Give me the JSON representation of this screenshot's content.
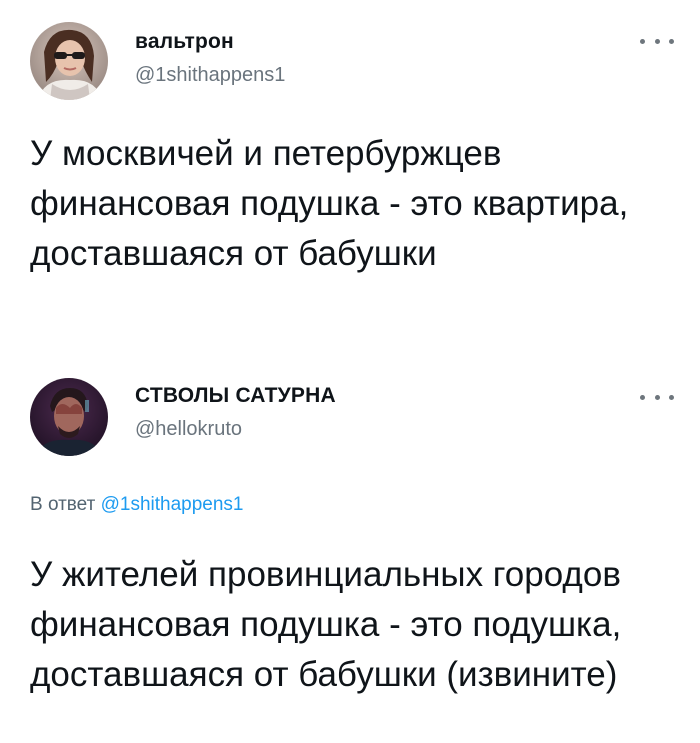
{
  "tweets": [
    {
      "author": {
        "display_name": "вальтрон",
        "handle": "@1shithappens1",
        "avatar_icon": "avatar-photo-woman-sunglasses"
      },
      "more_icon": "more-horizontal-icon",
      "text": "У москвичей и петербуржцев финансовая подушка - это квартира, доставшаяся от бабушки"
    },
    {
      "author": {
        "display_name": "СТВОЛЫ САТУРНА",
        "handle": "@hellokruto",
        "avatar_icon": "avatar-photo-man-dark-purple"
      },
      "more_icon": "more-horizontal-icon",
      "reply": {
        "prefix": "В ответ",
        "mention": "@1shithappens1"
      },
      "text": "У жителей провинциальных городов финансовая подушка - это подушка, доставшаяся от бабушки (извините)"
    }
  ],
  "colors": {
    "text": "#0f1419",
    "secondary": "#6a747d",
    "mention": "#1d9bf0",
    "background": "#ffffff"
  }
}
